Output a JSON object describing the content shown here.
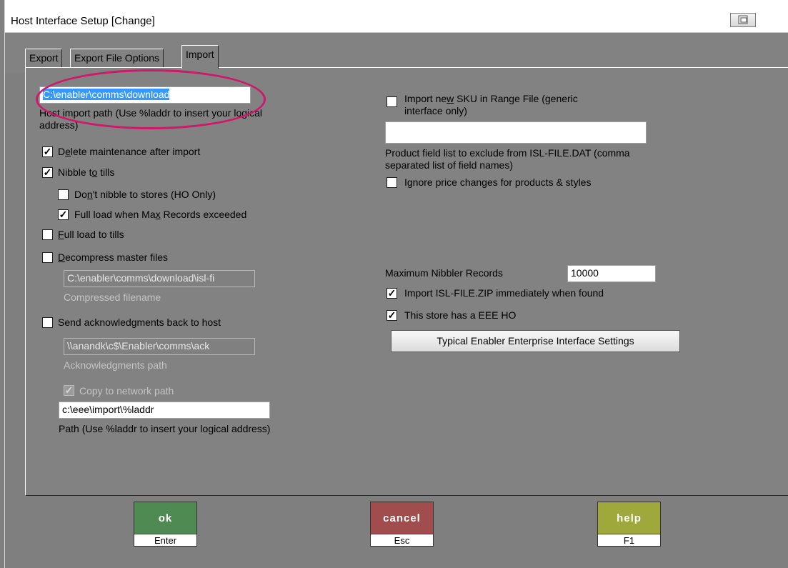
{
  "window": {
    "title": "Host Interface Setup  [Change]"
  },
  "tabs": [
    {
      "label": "Export"
    },
    {
      "label": "Export File Options"
    },
    {
      "label": "Import"
    }
  ],
  "left": {
    "host_import_path_value": "C:\\enabler\\comms\\download",
    "host_import_path_label": "Host import path (Use %laddr to insert your logical address)",
    "delete_maintenance": {
      "pre": "D",
      "u": "e",
      "post": "lete maintenance after import"
    },
    "nibble_to_tills": {
      "pre": "Nibble t",
      "u": "o",
      "post": " tills"
    },
    "dont_nibble": {
      "pre": "Do",
      "u": "n",
      "post": "'t nibble to stores (HO Only)"
    },
    "full_load_max": {
      "pre": "Full load when Ma",
      "u": "x",
      "post": " Records exceeded"
    },
    "full_load_tills": {
      "pre": "",
      "u": "F",
      "post": "ull load to tills"
    },
    "decompress": {
      "pre": "",
      "u": "D",
      "post": "ecompress master files"
    },
    "compressed_value": "C:\\enabler\\comms\\download\\isl-fi",
    "compressed_label": "Compressed filename",
    "send_ack": "Send acknowledgments back to host",
    "ack_value": "\\\\anandk\\c$\\Enabler\\comms\\ack",
    "ack_label": "Acknowledgments path",
    "copy_network": "Copy to network path",
    "network_path_value": "c:\\eee\\import\\%laddr",
    "network_path_label": "Path (Use %laddr to insert your logical address)"
  },
  "right": {
    "import_new_sku": {
      "pre": "Import ne",
      "u": "w",
      "post": " SKU in Range File (generic interface only)"
    },
    "product_field_value": "",
    "product_field_label": "Product field list to exclude from ISL-FILE.DAT (comma separated list of field names)",
    "ignore_price": "Ignore price changes for products & styles",
    "max_nibbler_label": "Maximum Nibbler Records",
    "max_nibbler_value": "10000",
    "import_zip": "Import ISL-FILE.ZIP immediately when found",
    "eee_ho": "This store has a EEE HO",
    "typical_button": "Typical Enabler Enterprise Interface Settings"
  },
  "buttons": {
    "ok": {
      "label": "ok",
      "key": "Enter",
      "color": "#4e8a52"
    },
    "cancel": {
      "label": "cancel",
      "key": "Esc",
      "color": "#a24d4d"
    },
    "help": {
      "label": "help",
      "key": "F1",
      "color": "#9fa83a"
    }
  },
  "checkbox_states": {
    "delete_maintenance": true,
    "nibble_to_tills": true,
    "dont_nibble": false,
    "full_load_max": true,
    "full_load_tills": false,
    "decompress": false,
    "send_ack": false,
    "copy_network": true,
    "import_new_sku": false,
    "ignore_price": false,
    "import_zip": true,
    "eee_ho": true
  },
  "colors": {
    "highlight_oval": "#d0186a",
    "selection": "#3399ff"
  }
}
